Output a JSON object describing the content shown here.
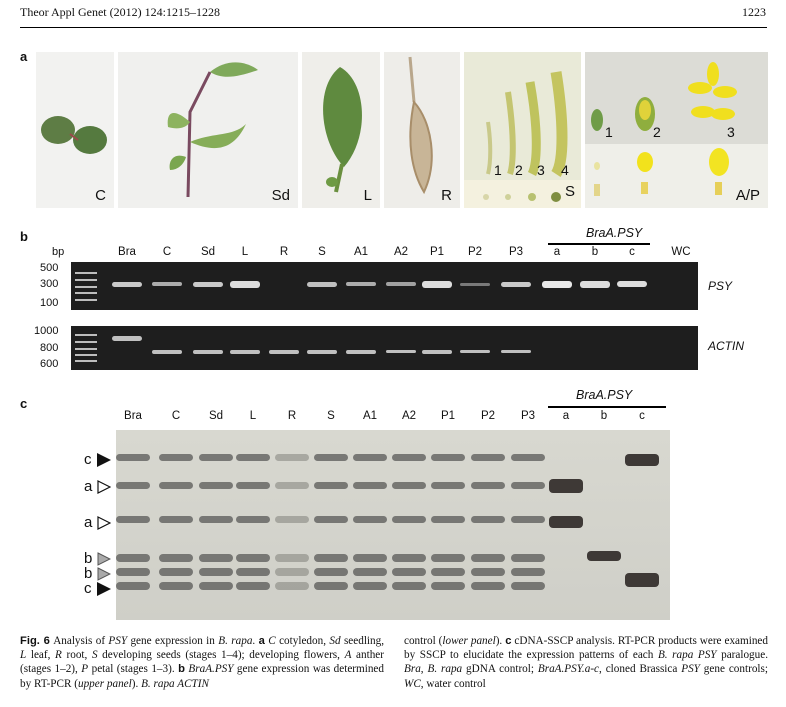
{
  "header": {
    "journal": "Theor Appl Genet (2012) 124:1215–1228",
    "page": "1223"
  },
  "panels": {
    "a": "a",
    "b": "b",
    "c": "c"
  },
  "photos": [
    {
      "label": "C"
    },
    {
      "label": "Sd"
    },
    {
      "label": "L"
    },
    {
      "label": "R"
    },
    {
      "label": "S"
    },
    {
      "label": "A/P"
    }
  ],
  "seed_stages": [
    "1",
    "2",
    "3",
    "4"
  ],
  "flower_stages": [
    "1",
    "2",
    "3"
  ],
  "gel": {
    "bp_label": "bp",
    "lanes": [
      "Bra",
      "C",
      "Sd",
      "L",
      "R",
      "S",
      "A1",
      "A2",
      "P1",
      "P2",
      "P3",
      "a",
      "b",
      "c",
      "WC"
    ],
    "bracket_label": "BraA.PSY",
    "psy_ladder": [
      "500",
      "300",
      "100"
    ],
    "actin_ladder": [
      "1000",
      "800",
      "600"
    ],
    "psy_label": "PSY",
    "actin_label": "ACTIN"
  },
  "sscp": {
    "lanes": [
      "Bra",
      "C",
      "Sd",
      "L",
      "R",
      "S",
      "A1",
      "A2",
      "P1",
      "P2",
      "P3",
      "a",
      "b",
      "c"
    ],
    "bracket_label": "BraA.PSY",
    "markers": [
      "c",
      "a",
      "a",
      "b",
      "b",
      "c"
    ]
  },
  "caption": {
    "fig": "Fig. 6",
    "col1": [
      {
        "t": "Analysis of "
      },
      {
        "i": "PSY"
      },
      {
        "t": " gene expression in "
      },
      {
        "i": "B. rapa"
      },
      {
        "t": ". "
      },
      {
        "b": "a"
      },
      {
        "t": " "
      },
      {
        "i": "C"
      },
      {
        "t": " cotyledon, "
      },
      {
        "i": "Sd"
      },
      {
        "t": " seedling, "
      },
      {
        "i": "L"
      },
      {
        "t": " leaf, "
      },
      {
        "i": "R"
      },
      {
        "t": " root, "
      },
      {
        "i": "S"
      },
      {
        "t": " developing seeds (stages 1–4); developing flowers, "
      },
      {
        "i": "A"
      },
      {
        "t": " anther (stages 1–2), "
      },
      {
        "i": "P"
      },
      {
        "t": " petal (stages 1–3). "
      },
      {
        "b": "b"
      },
      {
        "t": " "
      },
      {
        "i": "BraA.PSY"
      },
      {
        "t": " gene expression was determined by RT-PCR ("
      },
      {
        "i": "upper panel"
      },
      {
        "t": "). "
      },
      {
        "i": "B. rapa ACTIN"
      }
    ],
    "col2": [
      {
        "t": "control ("
      },
      {
        "i": "lower panel"
      },
      {
        "t": "). "
      },
      {
        "b": "c"
      },
      {
        "t": " cDNA-SSCP analysis. RT-PCR products were examined by SSCP to elucidate the expression patterns of each "
      },
      {
        "i": "B. rapa PSY"
      },
      {
        "t": " paralogue. "
      },
      {
        "i": "Bra"
      },
      {
        "t": ", "
      },
      {
        "i": "B. rapa"
      },
      {
        "t": " gDNA control; "
      },
      {
        "i": "BraA.PSY.a-c"
      },
      {
        "t": ", cloned Brassica "
      },
      {
        "i": "PSY"
      },
      {
        "t": " gene controls; "
      },
      {
        "i": "WC"
      },
      {
        "t": ", water control"
      }
    ]
  }
}
